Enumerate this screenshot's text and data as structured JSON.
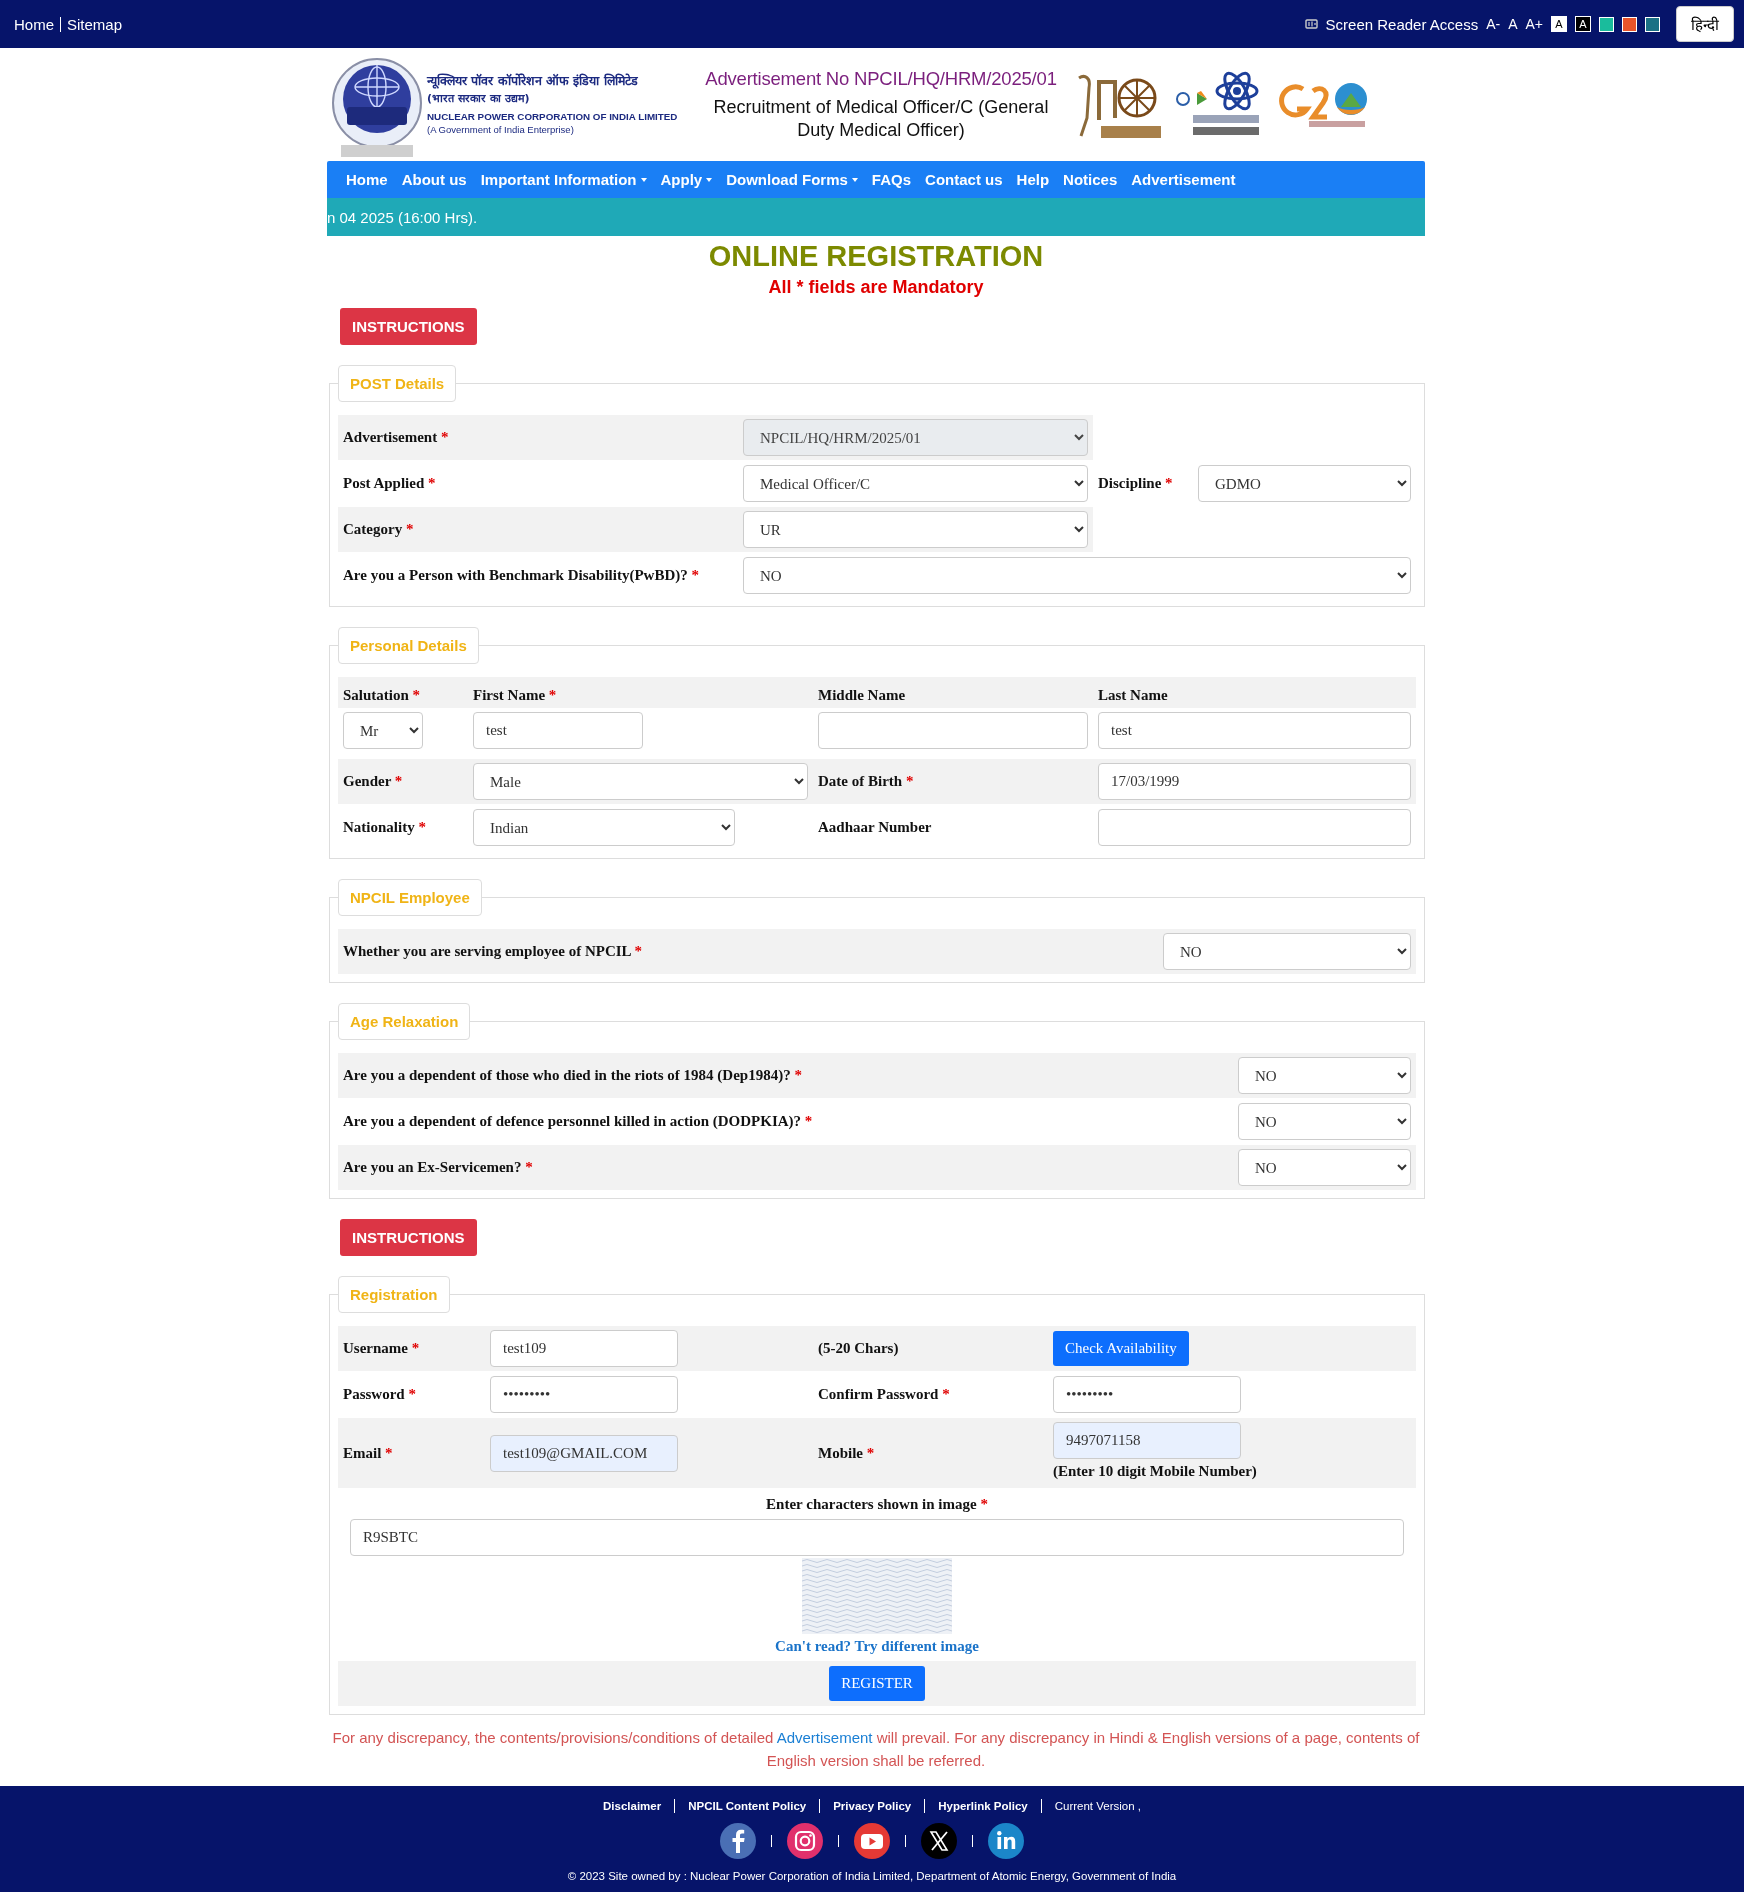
{
  "top_bar": {
    "links": [
      "Home",
      "Sitemap"
    ],
    "screen_reader": "Screen Reader Access",
    "font_sizes": [
      "A-",
      "A",
      "A+"
    ],
    "contrast": [
      {
        "label": "A",
        "kind": "light"
      },
      {
        "label": "A",
        "kind": "dark"
      }
    ],
    "color_swatches": [
      {
        "color": "#1abc9c"
      },
      {
        "color": "#e8542b"
      },
      {
        "color": "#1b7185"
      }
    ],
    "language": "हिन्दी"
  },
  "header": {
    "org_hindi": "न्यूक्लियर पॉवर कॉर्पोरेशन ऑफ इंडिया लिमिटेड",
    "org_hindi_sub": "(भारत सरकार का उद्यम)",
    "org_english": "NUCLEAR POWER CORPORATION OF INDIA LIMITED",
    "org_english_sub": "(A Government of India Enterprise)",
    "advertisement_no": "Advertisement No NPCIL/HQ/HRM/2025/01",
    "recruitment_title": "Recruitment of Medical Officer/C (General Duty Medical Officer)"
  },
  "nav": [
    {
      "label": "Home",
      "dropdown": false
    },
    {
      "label": "About us",
      "dropdown": false
    },
    {
      "label": "Important Information",
      "dropdown": true
    },
    {
      "label": "Apply",
      "dropdown": true
    },
    {
      "label": "Download Forms",
      "dropdown": true
    },
    {
      "label": "FAQs",
      "dropdown": false
    },
    {
      "label": "Contact us",
      "dropdown": false
    },
    {
      "label": "Help",
      "dropdown": false
    },
    {
      "label": "Notices",
      "dropdown": false
    },
    {
      "label": "Advertisement",
      "dropdown": false
    }
  ],
  "ticker": "n 04 2025 (16:00 Hrs).",
  "form": {
    "title": "ONLINE REGISTRATION",
    "mandatory_note": "All * fields are Mandatory",
    "items": [
      {
        "kind": "button",
        "text": "INSTRUCTIONS"
      },
      {
        "kind": "fieldset",
        "title": "POST Details",
        "rows": [
          [
            {
              "kind": "label",
              "text": "Advertisement",
              "mark": "*"
            },
            {
              "kind": "select",
              "value": "NPCIL/HQ/HRM/2025/01",
              "disabled": true
            }
          ],
          [
            {
              "kind": "label",
              "text": "Post Applied",
              "mark": "*"
            },
            {
              "kind": "select",
              "value": "Medical Officer/C",
              "disabled": false
            },
            {
              "kind": "label",
              "text": "Discipline",
              "mark": "*"
            },
            {
              "kind": "select",
              "value": "GDMO",
              "disabled": false
            }
          ],
          [
            {
              "kind": "label",
              "text": "Category",
              "mark": "*"
            },
            {
              "kind": "select",
              "value": "UR",
              "disabled": false
            }
          ],
          [
            {
              "kind": "label",
              "text": "Are you a Person with Benchmark Disability(PwBD)?",
              "mark": "*"
            },
            {
              "kind": "select",
              "value": "NO",
              "disabled": false
            }
          ]
        ]
      },
      {
        "kind": "fieldset",
        "title": "Personal Details",
        "rows": [
          [
            {
              "kind": "stacked",
              "label": "Salutation",
              "mark": "*",
              "control": {
                "kind": "select",
                "value": "Mr",
                "disabled": false
              }
            },
            {
              "kind": "stacked",
              "label": "First Name",
              "mark": "*",
              "control": {
                "kind": "input",
                "value": "test",
                "autofilled": false
              }
            },
            {
              "kind": "stacked",
              "label": "Middle Name",
              "control": {
                "kind": "input",
                "autofilled": false
              }
            },
            {
              "kind": "stacked",
              "label": "Last Name",
              "control": {
                "kind": "input",
                "value": "test",
                "autofilled": false
              }
            }
          ],
          [
            {
              "kind": "label",
              "text": "Gender",
              "mark": "*"
            },
            {
              "kind": "select",
              "value": "Male",
              "disabled": false
            },
            {
              "kind": "label",
              "text": "Date of Birth",
              "mark": "*"
            },
            {
              "kind": "input",
              "value": "17/03/1999",
              "autofilled": false
            }
          ],
          [
            {
              "kind": "label",
              "text": "Nationality",
              "mark": "*"
            },
            {
              "kind": "select",
              "value": "Indian",
              "disabled": false
            },
            {
              "kind": "label",
              "text": "Aadhaar Number"
            },
            {
              "kind": "input",
              "autofilled": false
            }
          ]
        ]
      },
      {
        "kind": "fieldset",
        "title": "NPCIL Employee",
        "rows": [
          [
            {
              "kind": "label",
              "text": "Whether you are serving employee of NPCIL",
              "mark": "*"
            },
            {
              "kind": "select",
              "value": "NO",
              "disabled": false
            }
          ]
        ]
      },
      {
        "kind": "fieldset",
        "title": "Age Relaxation",
        "rows": [
          [
            {
              "kind": "label",
              "text": "Are you a dependent of those who died in the riots of 1984 (Dep1984)?",
              "mark": "*"
            },
            {
              "kind": "select",
              "value": "NO",
              "disabled": false
            }
          ],
          [
            {
              "kind": "label",
              "text": "Are you a dependent of defence personnel killed in action (DODPKIA)?",
              "mark": "*"
            },
            {
              "kind": "select",
              "value": "NO",
              "disabled": false
            }
          ],
          [
            {
              "kind": "label",
              "text": "Are you an Ex-Servicemen?",
              "mark": "*"
            },
            {
              "kind": "select",
              "value": "NO",
              "disabled": false
            }
          ]
        ]
      },
      {
        "kind": "button",
        "text": "INSTRUCTIONS"
      },
      {
        "kind": "fieldset",
        "title": "Registration",
        "rows": [
          [
            {
              "kind": "label",
              "text": "Username",
              "mark": "*"
            },
            {
              "kind": "input",
              "value": "test109",
              "autofilled": false
            },
            {
              "kind": "note",
              "text": "(5-20 Chars)"
            },
            {
              "kind": "button",
              "text": "Check Availability"
            }
          ],
          [
            {
              "kind": "label",
              "text": "Password",
              "mark": "*"
            },
            {
              "kind": "input",
              "value": "•••••••••",
              "autofilled": false
            },
            {
              "kind": "label",
              "text": "Confirm Password",
              "mark": "*"
            },
            {
              "kind": "input",
              "value": "•••••••••",
              "autofilled": false
            }
          ],
          [
            {
              "kind": "label",
              "text": "Email",
              "mark": "*"
            },
            {
              "kind": "input",
              "value": "test109@GMAIL.COM",
              "autofilled": true
            },
            {
              "kind": "label",
              "text": "Mobile",
              "mark": "*"
            },
            {
              "kind": "input",
              "value": "9497071158",
              "autofilled": true,
              "note": "(Enter 10 digit Mobile Number)"
            }
          ]
        ],
        "captcha": {
          "label": "Enter characters shown in image",
          "mark": "*",
          "value": "R9SBTC",
          "link": "Can't read? Try different image"
        },
        "submit": "REGISTER"
      }
    ]
  },
  "disclaimer": {
    "before": "For any discrepancy, the contents/provisions/conditions of detailed ",
    "link": "Advertisement",
    "after": " will prevail. For any discrepancy in Hindi & English versions of a page, contents of English version shall be referred."
  },
  "footer": {
    "links": [
      {
        "label": "Disclaimer",
        "kind": "link"
      },
      {
        "label": "NPCIL Content Policy",
        "kind": "link"
      },
      {
        "label": "Privacy Policy",
        "kind": "link"
      },
      {
        "label": "Hyperlink Policy",
        "kind": "link"
      },
      {
        "label": "Current Version ,",
        "kind": "text"
      }
    ],
    "copyright": "© 2023 Site owned by : Nuclear Power Corporation of India Limited, Department of Atomic Energy, Government of India"
  }
}
